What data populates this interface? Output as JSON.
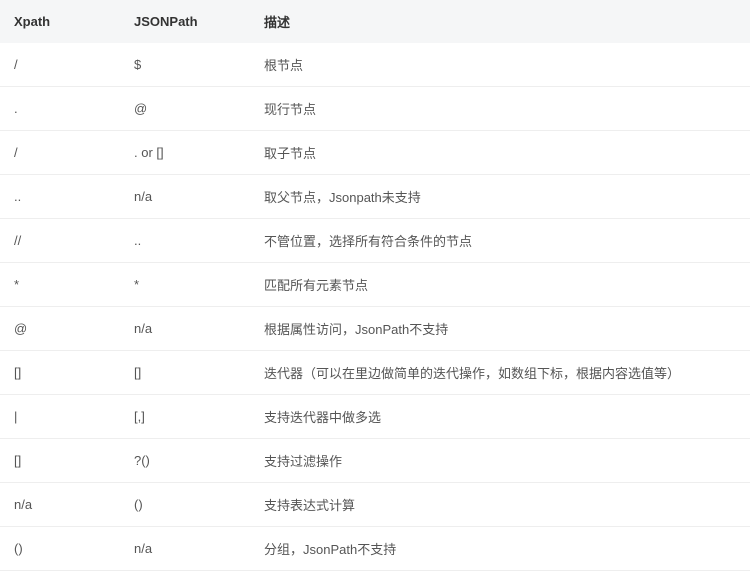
{
  "table": {
    "headers": [
      "Xpath",
      "JSONPath",
      "描述"
    ],
    "rows": [
      {
        "xpath": "/",
        "jsonpath": "$",
        "desc": "根节点"
      },
      {
        "xpath": ".",
        "jsonpath": "@",
        "desc": "现行节点"
      },
      {
        "xpath": "/",
        "jsonpath": ". or []",
        "desc": "取子节点"
      },
      {
        "xpath": "..",
        "jsonpath": "n/a",
        "desc": "取父节点，Jsonpath未支持"
      },
      {
        "xpath": "//",
        "jsonpath": "..",
        "desc": "不管位置，选择所有符合条件的节点"
      },
      {
        "xpath": "*",
        "jsonpath": "*",
        "desc": "匹配所有元素节点"
      },
      {
        "xpath": "@",
        "jsonpath": "n/a",
        "desc": "根据属性访问，JsonPath不支持"
      },
      {
        "xpath": "[]",
        "jsonpath": "[]",
        "desc": "迭代器（可以在里边做简单的迭代操作，如数组下标，根据内容选值等）"
      },
      {
        "xpath": "|",
        "jsonpath": "[,]",
        "desc": "支持迭代器中做多选"
      },
      {
        "xpath": "[]",
        "jsonpath": "?()",
        "desc": "支持过滤操作"
      },
      {
        "xpath": "n/a",
        "jsonpath": "()",
        "desc": "支持表达式计算"
      },
      {
        "xpath": "()",
        "jsonpath": "n/a",
        "desc": "分组，JsonPath不支持"
      }
    ]
  }
}
